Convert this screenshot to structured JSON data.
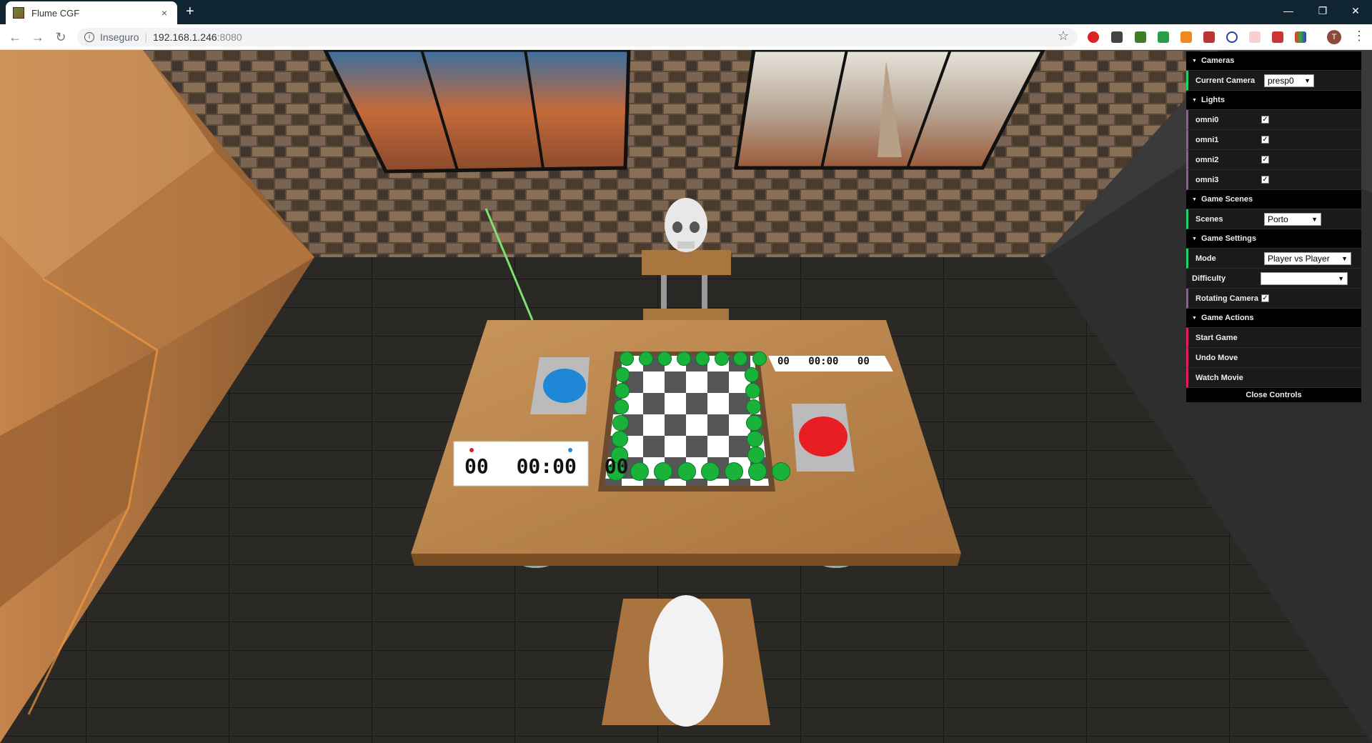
{
  "browser": {
    "tab_title": "Flume CGF",
    "tab_close": "×",
    "new_tab": "+",
    "url_security": "Inseguro",
    "url_host": "192.168.1.246",
    "url_port": ":8080",
    "avatar_letter": "T",
    "window_controls": {
      "minimize": "—",
      "restore": "❐",
      "close": "✕"
    }
  },
  "scene": {
    "clock_left": {
      "left": "00",
      "center": "00:00",
      "right": "00"
    },
    "clock_right": {
      "left": "00",
      "center": "00:00",
      "right": "00"
    }
  },
  "gui": {
    "cameras": {
      "title": "Cameras",
      "current_camera_label": "Current Camera",
      "current_camera_value": "presp0"
    },
    "lights": {
      "title": "Lights",
      "items": [
        {
          "label": "omni0",
          "checked": true
        },
        {
          "label": "omni1",
          "checked": true
        },
        {
          "label": "omni2",
          "checked": true
        },
        {
          "label": "omni3",
          "checked": true
        }
      ]
    },
    "scenes": {
      "title": "Game Scenes",
      "label": "Scenes",
      "value": "Porto"
    },
    "settings": {
      "title": "Game Settings",
      "mode_label": "Mode",
      "mode_value": "Player vs Player",
      "difficulty_label": "Difficulty",
      "difficulty_value": "",
      "rotating_label": "Rotating Camera",
      "rotating_checked": true
    },
    "actions": {
      "title": "Game Actions",
      "start": "Start Game",
      "undo": "Undo Move",
      "movie": "Watch Movie"
    },
    "close_controls": "Close Controls"
  }
}
